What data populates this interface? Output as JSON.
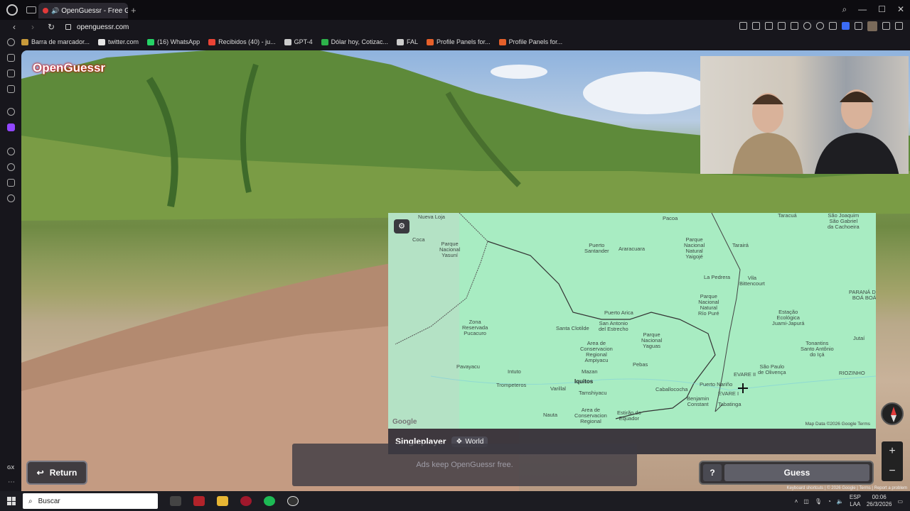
{
  "browser": {
    "tab_title": "OpenGuessr - Free Ge",
    "url": "openguessr.com"
  },
  "bookmarks": [
    {
      "label": "Barra de marcador...",
      "color": "#c89a3a"
    },
    {
      "label": "twitter.com",
      "color": "#e6e6e6"
    },
    {
      "label": "(16) WhatsApp",
      "color": "#25d366"
    },
    {
      "label": "Recibidos (40) - ju...",
      "color": "#ea4335"
    },
    {
      "label": "GPT-4",
      "color": "#cccccc"
    },
    {
      "label": "Dólar hoy, Cotizac...",
      "color": "#2db34a"
    },
    {
      "label": "FAL",
      "color": "#cccccc"
    },
    {
      "label": "Profile Panels for...",
      "color": "#e6602a"
    },
    {
      "label": "Profile Panels for...",
      "color": "#e6602a"
    }
  ],
  "sidebar": {
    "gx_label": "GX"
  },
  "game": {
    "logo": "OpenGuessr",
    "mode": "Singleplayer",
    "map_pool": "World",
    "ads_text": "Ads keep OpenGuessr free.",
    "return_label": "Return",
    "help_label": "?",
    "guess_label": "Guess",
    "zoom_in": "+",
    "zoom_out": "−",
    "street_attrib": "Keyboard shortcuts  |  © 2026 Google  |  Terms  |  Report a problem"
  },
  "map": {
    "google_logo": "Google",
    "attribution": "Map Data ©2026 Google      Terms",
    "labels": [
      {
        "text": "Nueva Loja"
      },
      {
        "text": "Coca"
      },
      {
        "text": "Parque\nNacional\nYasuní"
      },
      {
        "text": "Pacoa"
      },
      {
        "text": "Puerto\nSantander"
      },
      {
        "text": "Araracuara"
      },
      {
        "text": "Parque\nNacional\nNatural\nYaigojé"
      },
      {
        "text": "Taracuá"
      },
      {
        "text": "São Joaquim\nSão Gabriel\nda Cachoeira"
      },
      {
        "text": "Tarairá"
      },
      {
        "text": "La Pedrera"
      },
      {
        "text": "Vila\nBittencourt"
      },
      {
        "text": "Parque\nNacional\nNatural\nRío Puré"
      },
      {
        "text": "PARANÁ DO\nBOÁ BOÁ"
      },
      {
        "text": "Estação\nEcológica\nJuami-Japurá"
      },
      {
        "text": "Zona\nReservada\nPucacuro"
      },
      {
        "text": "Puerto Arica"
      },
      {
        "text": "Santa Clotilde"
      },
      {
        "text": "San Antonio\ndel Estrecho"
      },
      {
        "text": "Parque\nNacional\nYaguas"
      },
      {
        "text": "Area de\nConservacion\nRegional\nAmpiyacu"
      },
      {
        "text": "Jutaí"
      },
      {
        "text": "Tonantins\nSanto Antônio\ndo Içá"
      },
      {
        "text": "Pavayacu"
      },
      {
        "text": "Intuto"
      },
      {
        "text": "Mazan"
      },
      {
        "text": "Pebas"
      },
      {
        "text": "São Paulo\nde Olivença"
      },
      {
        "text": "RIOZINHO"
      },
      {
        "text": "EVARE II"
      },
      {
        "text": "Iquitos"
      },
      {
        "text": "Trompeteros"
      },
      {
        "text": "Varillal"
      },
      {
        "text": "Tamshiyacu"
      },
      {
        "text": "Caballococha"
      },
      {
        "text": "Puerto Nariño"
      },
      {
        "text": "EVARE I"
      },
      {
        "text": "Benjamin\nConstant"
      },
      {
        "text": "Tabatinga"
      },
      {
        "text": "Nauta"
      },
      {
        "text": "Area de\nConservacion\nRegional"
      },
      {
        "text": "Estirão do\nEquador"
      }
    ]
  },
  "taskbar": {
    "search_placeholder": "Buscar",
    "lang": "ESP\nLAA",
    "time": "00:06",
    "date": "26/3/2026"
  }
}
